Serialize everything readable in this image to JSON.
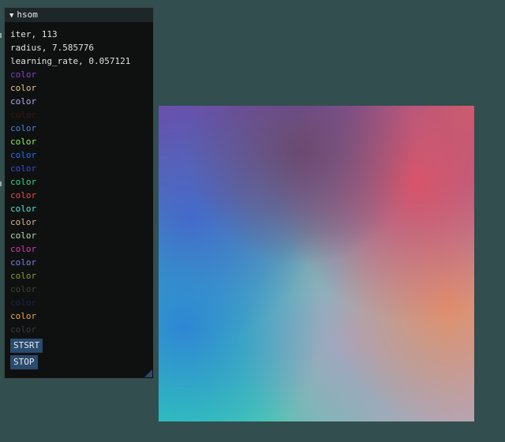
{
  "window": {
    "title": "hsom",
    "collapse_icon": "triangle-down"
  },
  "stats": {
    "iter": "iter, 113",
    "radius": "radius, 7.585776",
    "learning_rate": "learning_rate, 0.057121"
  },
  "colors": [
    {
      "label": "color",
      "hex": "#8a3fc8"
    },
    {
      "label": "color",
      "hex": "#e0c58a"
    },
    {
      "label": "color",
      "hex": "#b8a4f0"
    },
    {
      "label": "color",
      "hex": "#3d1414"
    },
    {
      "label": "color",
      "hex": "#4a7fd8"
    },
    {
      "label": "color",
      "hex": "#9ae86a"
    },
    {
      "label": "color",
      "hex": "#2a6ef0"
    },
    {
      "label": "color",
      "hex": "#3e48d4"
    },
    {
      "label": "color",
      "hex": "#3ed488"
    },
    {
      "label": "color",
      "hex": "#e84a4a"
    },
    {
      "label": "color",
      "hex": "#56e0d4"
    },
    {
      "label": "color",
      "hex": "#dab496"
    },
    {
      "label": "color",
      "hex": "#bed8b4"
    },
    {
      "label": "color",
      "hex": "#d83ab0"
    },
    {
      "label": "color",
      "hex": "#7c7ee0"
    },
    {
      "label": "color",
      "hex": "#8a9a3a"
    },
    {
      "label": "color",
      "hex": "#3e4232"
    },
    {
      "label": "color",
      "hex": "#1a2450"
    },
    {
      "label": "color",
      "hex": "#f0a04a"
    },
    {
      "label": "color",
      "hex": "#3e3642"
    }
  ],
  "buttons": {
    "start": "STSRT",
    "stop": "STOP"
  },
  "som_map": {
    "corner_colors": {
      "top_left": "#6a50a8",
      "top_right": "#c8606e",
      "bottom_left": "#2ed2b6",
      "bottom_right": "#b4a4b4"
    },
    "blobs": [
      {
        "color": "#6a4a70"
      },
      {
        "color": "#d8546a"
      },
      {
        "color": "#2f86d4"
      },
      {
        "color": "#4a62c8"
      },
      {
        "color": "#e0906c"
      },
      {
        "color": "#a8a4c0"
      }
    ]
  }
}
